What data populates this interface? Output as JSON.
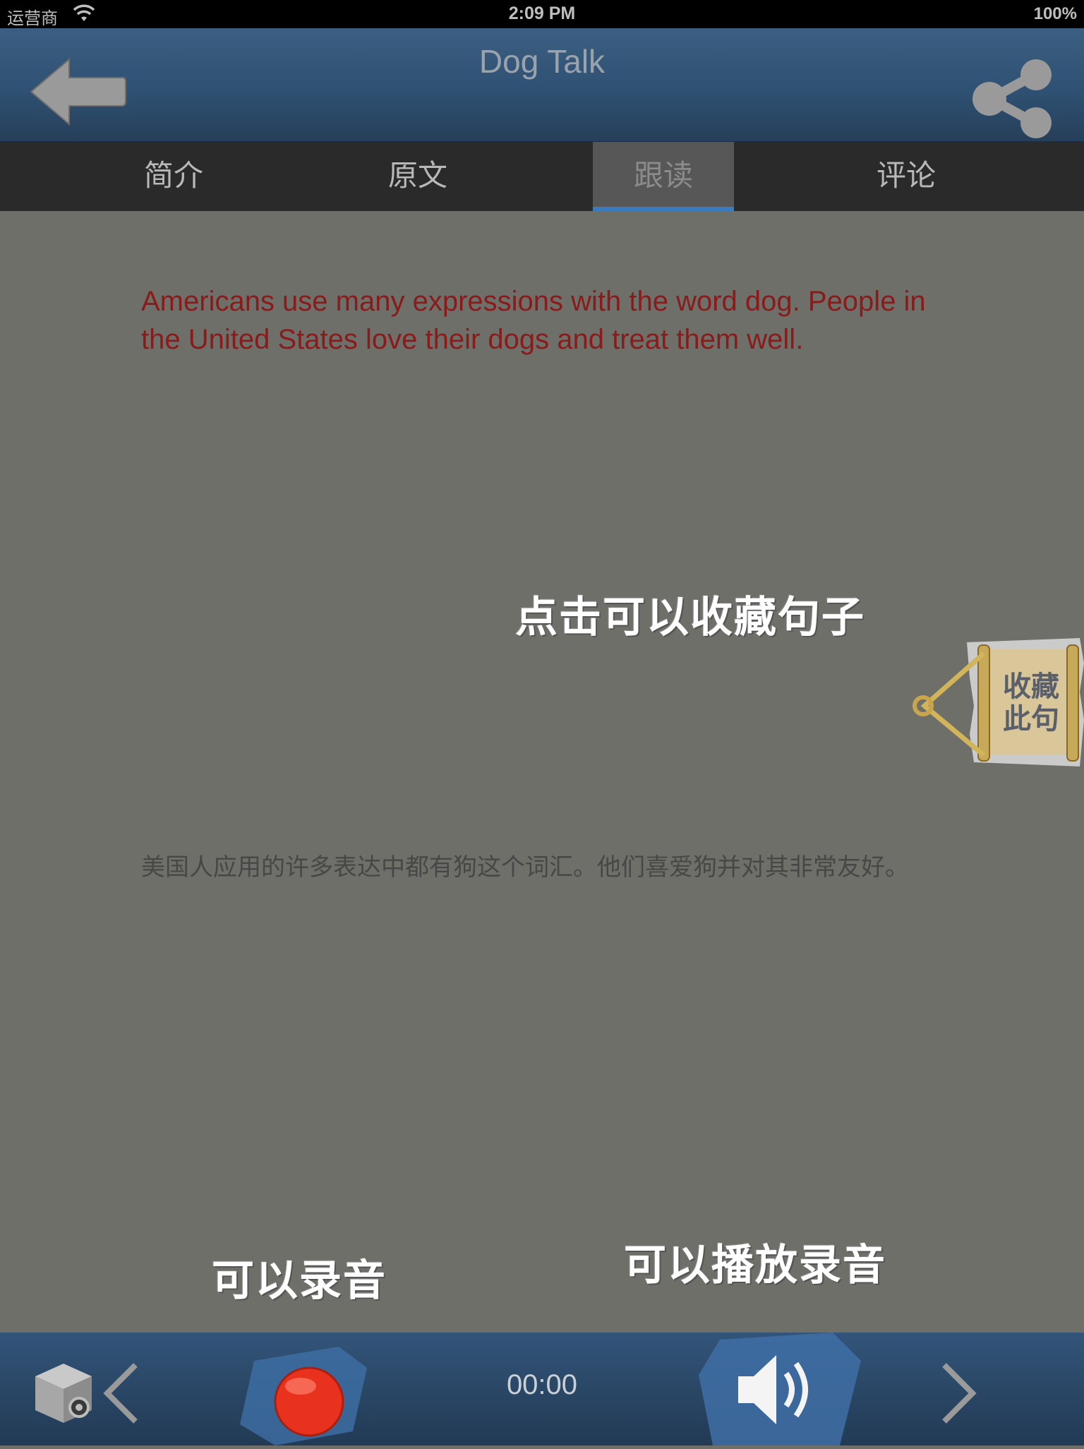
{
  "status_bar": {
    "carrier": "运营商",
    "time": "2:09 PM",
    "battery": "100%"
  },
  "nav": {
    "title": "Dog Talk",
    "back_icon": "back-arrow-icon",
    "share_icon": "share-icon"
  },
  "tabs": [
    {
      "label": "简介",
      "active": false
    },
    {
      "label": "原文",
      "active": false
    },
    {
      "label": "跟读",
      "active": true
    },
    {
      "label": "评论",
      "active": false
    }
  ],
  "sentence": {
    "english": "Americans use many expressions with the word dog. People in the United States love their dogs and treat them well.",
    "chinese": "美国人应用的许多表达中都有狗这个词汇。他们喜爱狗并对其非常友好。"
  },
  "hints": {
    "favorite": "点击可以收藏句子",
    "record": "可以录音",
    "play": "可以播放录音"
  },
  "favorite_button": {
    "line1": "收藏",
    "line2": "此句"
  },
  "toolbar": {
    "timer": "00:00",
    "accent_record": "#e8321e",
    "accent_bar": "#2a4766"
  }
}
